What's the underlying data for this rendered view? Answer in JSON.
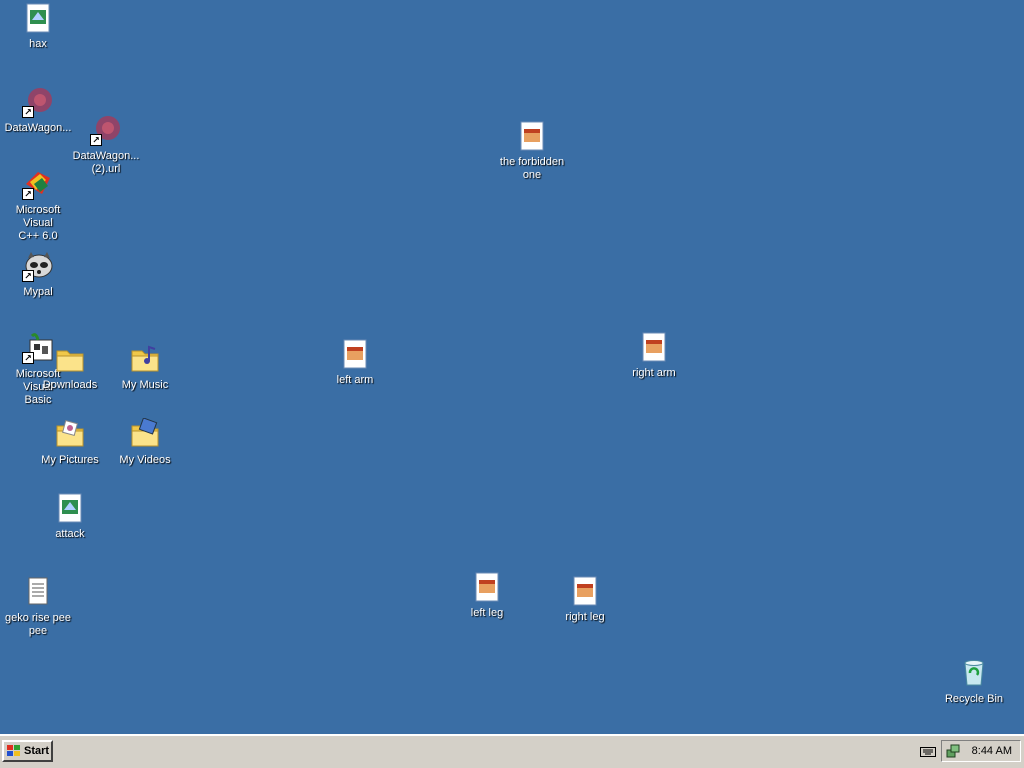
{
  "desktop": {
    "icons": [
      {
        "label": "hax",
        "type": "image"
      },
      {
        "label": "DataWagon...",
        "type": "url-shortcut"
      },
      {
        "label": "DataWagon...\n(2).url",
        "type": "url-shortcut"
      },
      {
        "label": "Microsoft Visual\nC++ 6.0",
        "type": "app-shortcut"
      },
      {
        "label": "Mypal",
        "type": "app-shortcut"
      },
      {
        "label": "Microsoft Visual\nBasic",
        "type": "app-shortcut"
      },
      {
        "label": "Downloads",
        "type": "folder"
      },
      {
        "label": "My Music",
        "type": "folder"
      },
      {
        "label": "My Pictures",
        "type": "folder"
      },
      {
        "label": "My Videos",
        "type": "folder"
      },
      {
        "label": "attack",
        "type": "image"
      },
      {
        "label": "geko rise pee\npee",
        "type": "text-file"
      },
      {
        "label": "the forbidden\none",
        "type": "image"
      },
      {
        "label": "left arm",
        "type": "image"
      },
      {
        "label": "right arm",
        "type": "image"
      },
      {
        "label": "left leg",
        "type": "image"
      },
      {
        "label": "right leg",
        "type": "image"
      },
      {
        "label": "Recycle Bin",
        "type": "recycle-bin"
      }
    ]
  },
  "taskbar": {
    "start_label": "Start",
    "clock": "8:44 AM"
  },
  "colors": {
    "desktop_background": "#3a6ea5",
    "taskbar": "#d4d0c8"
  }
}
